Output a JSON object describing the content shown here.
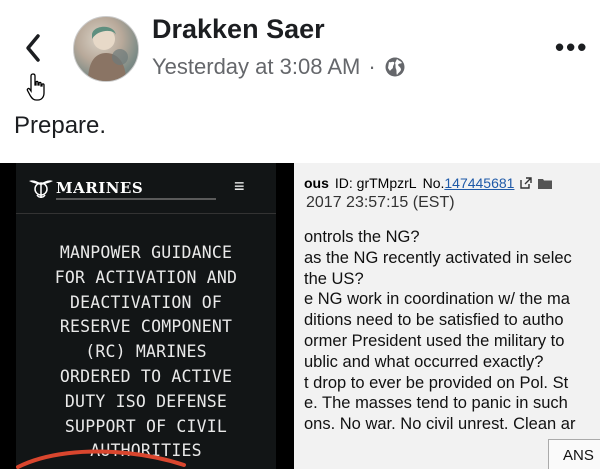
{
  "post": {
    "author": "Drakken Saer",
    "timestamp": "Yesterday at 3:08 AM",
    "separator": "·",
    "caption": "Prepare.",
    "more_label": "•••"
  },
  "marines_image": {
    "brand": "MARINES",
    "menu_icon": "≡",
    "lines": [
      "MANPOWER GUIDANCE",
      "FOR ACTIVATION AND",
      "DEACTIVATION OF",
      "RESERVE COMPONENT",
      "(RC) MARINES",
      "ORDERED TO ACTIVE",
      "DUTY ISO DEFENSE",
      "SUPPORT OF CIVIL",
      "AUTHORITIES"
    ]
  },
  "chan_image": {
    "name": "ous",
    "id_label": "ID: grTMpzrL",
    "no_label": "No.",
    "post_number": "147445681",
    "date": "2017 23:57:15 (EST)",
    "lines": [
      "ontrols the NG?",
      "as the NG recently activated in selec",
      "the US?",
      "e NG work in coordination w/ the ma",
      "ditions need to be satisfied to autho",
      "ormer President used the military to",
      "ublic and what occurred exactly?",
      "t drop to ever be provided on Pol. St",
      "e. The masses tend to panic in such",
      "ons. No war. No civil unrest. Clean ar"
    ],
    "ans": "ANS"
  },
  "icons": {
    "back": "chevron-left-icon",
    "cursor": "hand-pointer-icon",
    "audience": "globe-icon",
    "more": "more-horizontal-icon",
    "emblem": "eagle-globe-anchor-icon",
    "menu": "hamburger-menu-icon",
    "external": "external-link-icon",
    "folder": "folder-icon"
  },
  "colors": {
    "text": "#1c1e21",
    "meta": "#65676b",
    "link": "#1f5aa8",
    "marines_bg": "#121516"
  }
}
